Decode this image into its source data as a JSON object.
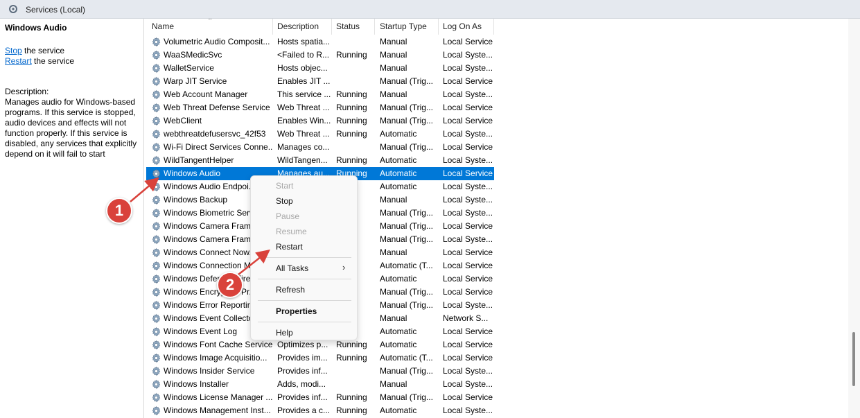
{
  "window": {
    "title": "Services (Local)"
  },
  "left_pane": {
    "service_name": "Windows Audio",
    "stop_link": "Stop",
    "stop_suffix": " the service",
    "restart_link": "Restart",
    "restart_suffix": " the service",
    "description_label": "Description:",
    "description_lines": [
      "Manages audio for Windows-based",
      "programs.  If this service is stopped,",
      "audio devices and effects will not",
      "function properly.  If this service is",
      "disabled, any services that explicitly",
      "depend on it will fail to start"
    ]
  },
  "columns": [
    "Name",
    "Description",
    "Status",
    "Startup Type",
    "Log On As"
  ],
  "rows": [
    [
      "Volumetric Audio Composit...",
      "Hosts spatia...",
      "",
      "Manual",
      "Local Service"
    ],
    [
      "WaaSMedicSvc",
      "<Failed to R...",
      "Running",
      "Manual",
      "Local Syste..."
    ],
    [
      "WalletService",
      "Hosts objec...",
      "",
      "Manual",
      "Local Syste..."
    ],
    [
      "Warp JIT Service",
      "Enables JIT ...",
      "",
      "Manual (Trig...",
      "Local Service"
    ],
    [
      "Web Account Manager",
      "This service ...",
      "Running",
      "Manual",
      "Local Syste..."
    ],
    [
      "Web Threat Defense Service",
      "Web Threat ...",
      "Running",
      "Manual (Trig...",
      "Local Service"
    ],
    [
      "WebClient",
      "Enables Win...",
      "Running",
      "Manual (Trig...",
      "Local Service"
    ],
    [
      "webthreatdefusersvc_42f53",
      "Web Threat ...",
      "Running",
      "Automatic",
      "Local Syste..."
    ],
    [
      "Wi-Fi Direct Services Conne...",
      "Manages co...",
      "",
      "Manual (Trig...",
      "Local Service"
    ],
    [
      "WildTangentHelper",
      "WildTangen...",
      "Running",
      "Automatic",
      "Local Syste..."
    ],
    [
      "Windows Audio",
      "Manages au...",
      "Running",
      "Automatic",
      "Local Service"
    ],
    [
      "Windows Audio Endpoi...",
      "",
      "",
      "Automatic",
      "Local Syste..."
    ],
    [
      "Windows Backup",
      "",
      "",
      "Manual",
      "Local Syste..."
    ],
    [
      "Windows Biometric Serv...",
      "",
      "",
      "Manual (Trig...",
      "Local Syste..."
    ],
    [
      "Windows Camera Fram...",
      "",
      "",
      "Manual (Trig...",
      "Local Service"
    ],
    [
      "Windows Camera Fram...",
      "",
      "",
      "Manual (Trig...",
      "Local Syste..."
    ],
    [
      "Windows Connect Now...",
      "",
      "",
      "Manual",
      "Local Service"
    ],
    [
      "Windows Connection M...",
      "",
      "",
      "Automatic (T...",
      "Local Service"
    ],
    [
      "Windows Defender Firew...",
      "",
      "",
      "Automatic",
      "Local Service"
    ],
    [
      "Windows Encryption Pr...",
      "",
      "",
      "Manual (Trig...",
      "Local Service"
    ],
    [
      "Windows Error Reporting...",
      "",
      "",
      "Manual (Trig...",
      "Local Syste..."
    ],
    [
      "Windows Event Collector",
      "",
      "",
      "Manual",
      "Network S..."
    ],
    [
      "Windows Event Log",
      "",
      "",
      "Automatic",
      "Local Service"
    ],
    [
      "Windows Font Cache Service",
      "Optimizes p...",
      "Running",
      "Automatic",
      "Local Service"
    ],
    [
      "Windows Image Acquisitio...",
      "Provides im...",
      "Running",
      "Automatic (T...",
      "Local Service"
    ],
    [
      "Windows Insider Service",
      "Provides inf...",
      "",
      "Manual (Trig...",
      "Local Syste..."
    ],
    [
      "Windows Installer",
      "Adds, modi...",
      "",
      "Manual",
      "Local Syste..."
    ],
    [
      "Windows License Manager ...",
      "Provides inf...",
      "Running",
      "Manual (Trig...",
      "Local Service"
    ],
    [
      "Windows Management Inst...",
      "Provides a c...",
      "Running",
      "Automatic",
      "Local Syste..."
    ]
  ],
  "selected_row": 10,
  "context_menu": {
    "start": "Start",
    "stop": "Stop",
    "pause": "Pause",
    "resume": "Resume",
    "restart": "Restart",
    "all_tasks": "All Tasks",
    "refresh": "Refresh",
    "properties": "Properties",
    "help": "Help"
  },
  "annotations": {
    "badge1": "1",
    "badge2": "2"
  },
  "colors": {
    "selection": "#0078d7",
    "badge": "#d9423b",
    "arrow": "#d9423b",
    "link": "#0066cc"
  }
}
